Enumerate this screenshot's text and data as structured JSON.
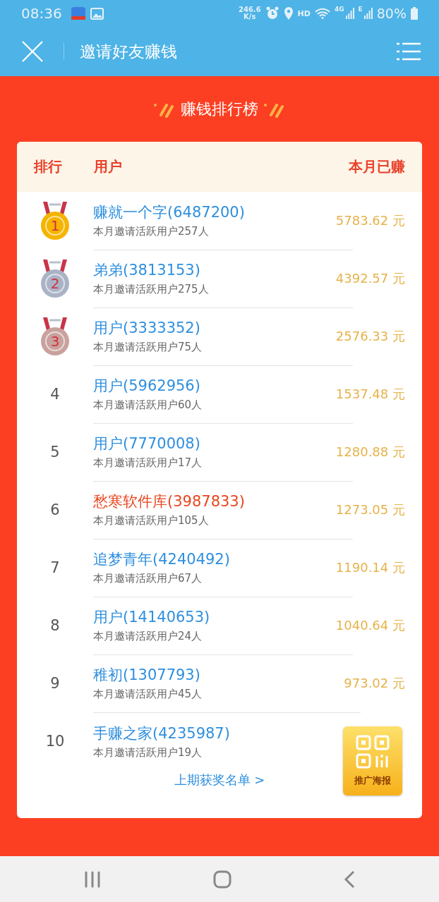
{
  "status_bar": {
    "time": "08:36",
    "speed": "246.6",
    "speed_unit": "K/s",
    "hd": "HD",
    "network": "4G",
    "network_2": "E",
    "battery": "80%"
  },
  "header": {
    "title": "邀请好友赚钱"
  },
  "board": {
    "title": "赚钱排行榜",
    "columns": [
      "排行",
      "用户",
      "本月已赚"
    ],
    "rows": [
      {
        "kind": "medal",
        "rank": "1",
        "color": "#f5b400",
        "name": "赚就一个字(6487200)",
        "sub": "本月邀请活跃用户257人",
        "amount": "5783.62 元",
        "highlighted": false
      },
      {
        "kind": "medal",
        "rank": "2",
        "color": "#aab3c6",
        "name": "弟弟(3813153)",
        "sub": "本月邀请活跃用户275人",
        "amount": "4392.57 元",
        "highlighted": false
      },
      {
        "kind": "medal",
        "rank": "3",
        "color": "#c9a29d",
        "name": "用户(3333352)",
        "sub": "本月邀请活跃用户75人",
        "amount": "2576.33 元",
        "highlighted": false
      },
      {
        "kind": "number",
        "rank": "4",
        "name": "用户(5962956)",
        "sub": "本月邀请活跃用户60人",
        "amount": "1537.48 元",
        "highlighted": false
      },
      {
        "kind": "number",
        "rank": "5",
        "name": "用户(7770008)",
        "sub": "本月邀请活跃用户17人",
        "amount": "1280.88 元",
        "highlighted": false
      },
      {
        "kind": "number",
        "rank": "6",
        "name": "愁寒软件库(3987833)",
        "sub": "本月邀请活跃用户105人",
        "amount": "1273.05 元",
        "highlighted": true
      },
      {
        "kind": "number",
        "rank": "7",
        "name": "追梦青年(4240492)",
        "sub": "本月邀请活跃用户67人",
        "amount": "1190.14 元",
        "highlighted": false
      },
      {
        "kind": "number",
        "rank": "8",
        "name": "用户(14140653)",
        "sub": "本月邀请活跃用户24人",
        "amount": "1040.64 元",
        "highlighted": false
      },
      {
        "kind": "number",
        "rank": "9",
        "name": "稚初(1307793)",
        "sub": "本月邀请活跃用户45人",
        "amount": "973.02 元",
        "highlighted": false
      },
      {
        "kind": "number",
        "rank": "10",
        "name": "手赚之家(4235987)",
        "sub": "本月邀请活跃用户19人",
        "highlighted": false
      }
    ],
    "footer_link": "上期获奖名单 >"
  },
  "poster_button": {
    "label": "推广海报"
  }
}
